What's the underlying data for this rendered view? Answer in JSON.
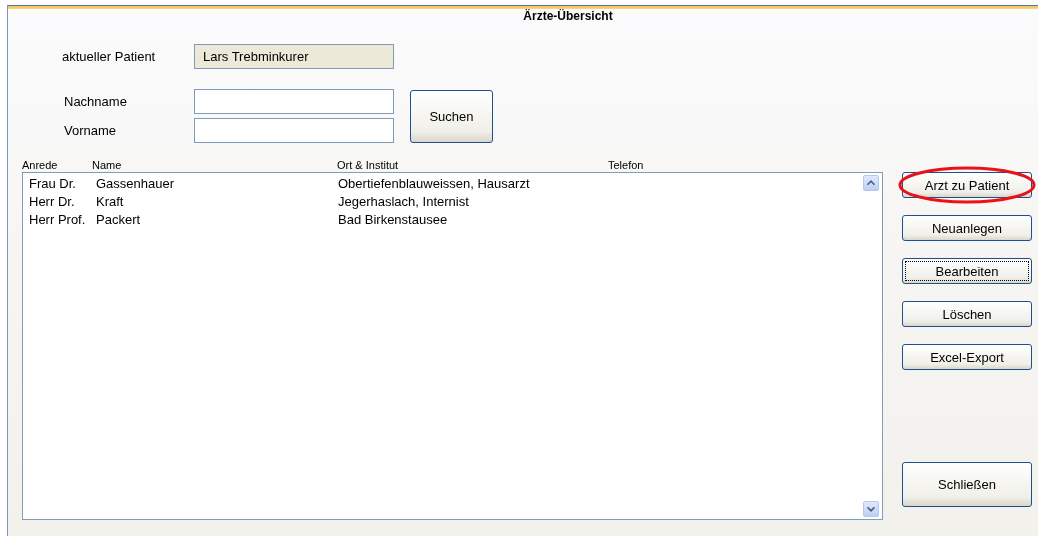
{
  "window": {
    "title": "Ärzte-Übersicht"
  },
  "patient": {
    "label": "aktueller Patient",
    "value": "Lars Trebminkurer"
  },
  "search": {
    "fields": [
      {
        "label": "Nachname"
      },
      {
        "label": "Vorname"
      }
    ],
    "button": "Suchen"
  },
  "table": {
    "columns": [
      "Anrede",
      "Name",
      "Ort & Institut",
      "Telefon"
    ],
    "rows": [
      {
        "cells": [
          "Frau Dr.",
          "Gassenhauer",
          "Obertiefenblauweissen, Hausarzt"
        ]
      },
      {
        "cells": [
          "Herr Dr.",
          "Kraft",
          "Jegerhaslach, Internist"
        ]
      },
      {
        "cells": [
          "Herr Prof.",
          "Packert",
          "Bad Birkenstausee"
        ]
      }
    ]
  },
  "actions": [
    {
      "label": "Arzt zu Patient",
      "focused": false,
      "highlighted": true
    },
    {
      "label": "Neuanlegen",
      "focused": false,
      "highlighted": false
    },
    {
      "label": "Bearbeiten",
      "focused": true,
      "highlighted": false
    },
    {
      "label": "Löschen",
      "focused": false,
      "highlighted": false
    },
    {
      "label": "Excel-Export",
      "focused": false,
      "highlighted": false
    }
  ],
  "close_button": "Schließen"
}
